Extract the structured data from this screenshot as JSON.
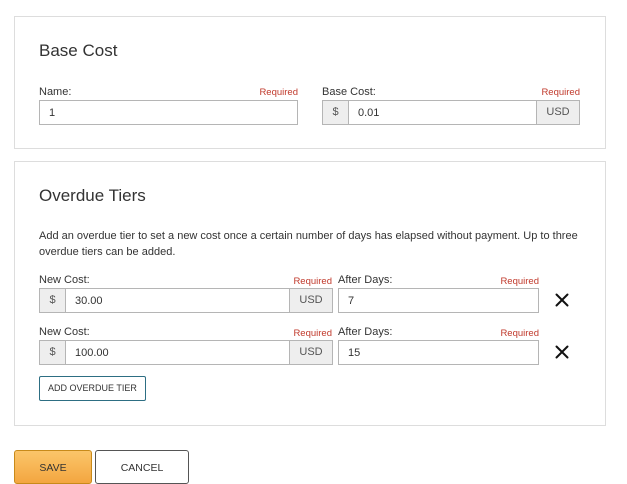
{
  "base_cost": {
    "title": "Base Cost",
    "name_label": "Name:",
    "name_required": "Required",
    "name_value": "1",
    "cost_label": "Base Cost:",
    "cost_required": "Required",
    "cost_prefix": "$",
    "cost_value": "0.01",
    "cost_suffix": "USD"
  },
  "overdue_tiers": {
    "title": "Overdue Tiers",
    "description": "Add an overdue tier to set a new cost once a certain number of days has elapsed without payment. Up to three overdue tiers can be added.",
    "tiers": [
      {
        "cost_label": "New Cost:",
        "cost_required": "Required",
        "cost_prefix": "$",
        "cost_value": "30.00",
        "cost_suffix": "USD",
        "days_label": "After Days:",
        "days_required": "Required",
        "days_value": "7"
      },
      {
        "cost_label": "New Cost:",
        "cost_required": "Required",
        "cost_prefix": "$",
        "cost_value": "100.00",
        "cost_suffix": "USD",
        "days_label": "After Days:",
        "days_required": "Required",
        "days_value": "15"
      }
    ],
    "add_button": "ADD OVERDUE TIER"
  },
  "actions": {
    "save": "SAVE",
    "cancel": "CANCEL"
  },
  "icons": {
    "remove": "close-icon"
  },
  "colors": {
    "required_text": "#c0392b",
    "save_button": "#f3a640",
    "add_button_border": "#2d6e83",
    "panel_border": "#dddddd"
  }
}
